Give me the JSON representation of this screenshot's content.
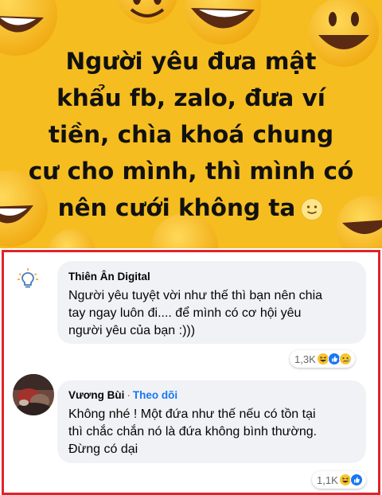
{
  "post": {
    "background": "#f5bd1f",
    "lines": [
      "Người yêu đưa mật",
      "khẩu fb, zalo, đưa ví",
      "tiền, chìa khoá chung",
      "cư cho mình, thì mình có",
      "nên cưới không ta"
    ],
    "trailing_icon": "slightly-smiling-emoji"
  },
  "comments": [
    {
      "author": "Thiên Ân Digital",
      "avatar_icon": "lightbulb-logo",
      "lines": [
        "Người yêu tuyệt vời như thế thì bạn nên chia",
        "tay ngay luôn đi.... để mình có cơ hội yêu",
        "người yêu của bạn :)))"
      ],
      "reaction_count": "1,3K",
      "reaction_icons": [
        "haha-icon",
        "like-icon",
        "sad-icon"
      ]
    },
    {
      "author": "Vương Bùi",
      "follow_separator": "·",
      "follow_label": "Theo dõi",
      "avatar_icon": "user-photo",
      "lines": [
        "Không nhé ! Một đứa như thế nếu có tồn tại",
        "thì chắc chắn nó là đứa không bình thường.",
        "Đừng có dại"
      ],
      "reaction_count": "1,1K",
      "reaction_icons": [
        "haha-icon",
        "like-icon"
      ]
    }
  ],
  "colors": {
    "highlight_border": "#e0242a",
    "link_blue": "#1877f2",
    "bubble": "#f0f2f5"
  }
}
